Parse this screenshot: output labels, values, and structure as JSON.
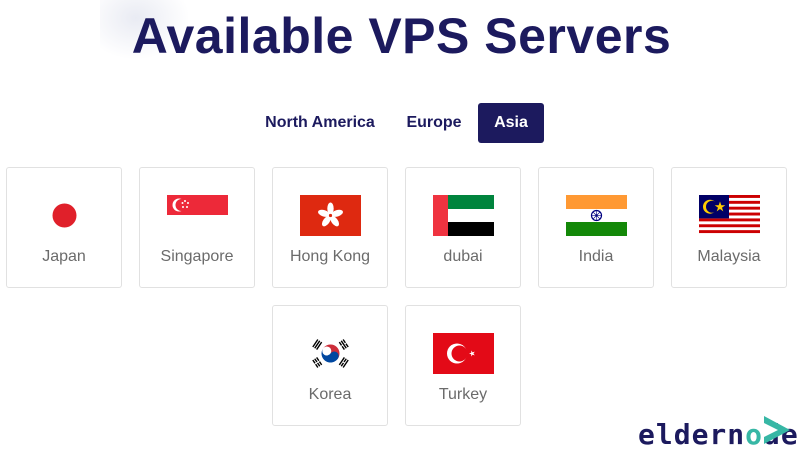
{
  "page": {
    "title": "Available VPS Servers"
  },
  "tabs": [
    {
      "label": "North America",
      "active": false
    },
    {
      "label": "Europe",
      "active": false
    },
    {
      "label": "Asia",
      "active": true
    }
  ],
  "servers": [
    {
      "name": "Japan",
      "flag": "japan-flag-icon"
    },
    {
      "name": "Singapore",
      "flag": "singapore-flag-icon"
    },
    {
      "name": "Hong Kong",
      "flag": "hong-kong-flag-icon"
    },
    {
      "name": "dubai",
      "flag": "uae-flag-icon"
    },
    {
      "name": "India",
      "flag": "india-flag-icon"
    },
    {
      "name": "Malaysia",
      "flag": "malaysia-flag-icon"
    },
    {
      "name": "Korea",
      "flag": "korea-flag-icon"
    },
    {
      "name": "Turkey",
      "flag": "turkey-flag-icon"
    }
  ],
  "logo": {
    "text_start": "elder",
    "text_o": "o",
    "text_end_n": "n",
    "text_end": "de",
    "mark": "play-triangle-logo-icon"
  },
  "colors": {
    "brand": "#1c1a5e",
    "accent": "#37b7a5",
    "label": "#6b6b6b",
    "border": "#e1e1e1"
  }
}
